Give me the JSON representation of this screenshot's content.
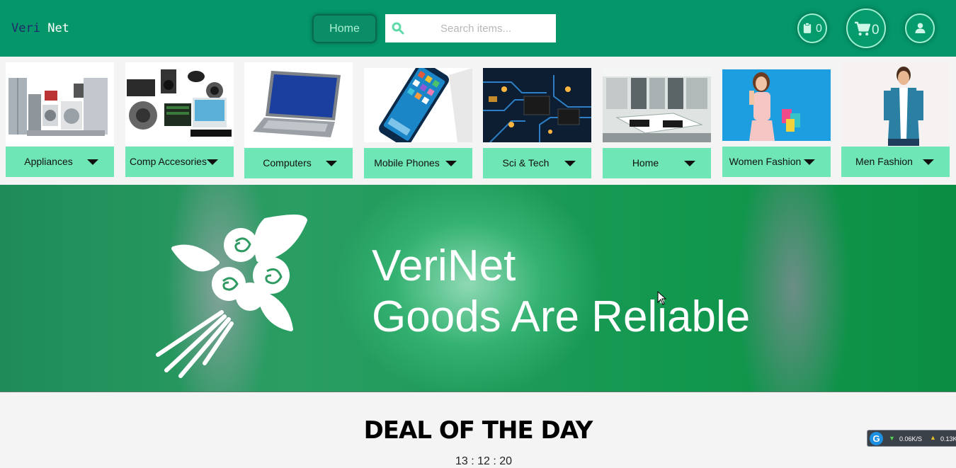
{
  "brand": {
    "part1": "Veri",
    "part2": "Net"
  },
  "nav": {
    "home_label": "Home",
    "search_placeholder": "Search items..."
  },
  "header": {
    "orders_count": "0",
    "cart_count": "0"
  },
  "categories": [
    {
      "label": "Appliances",
      "icon": "appliances-image"
    },
    {
      "label": "Comp Accesories",
      "icon": "computer-accessories-image"
    },
    {
      "label": "Computers",
      "icon": "laptop-image"
    },
    {
      "label": "Mobile Phones",
      "icon": "smartphone-image"
    },
    {
      "label": "Sci & Tech",
      "icon": "circuit-board-image"
    },
    {
      "label": "Home",
      "icon": "kitchen-image"
    },
    {
      "label": "Women Fashion",
      "icon": "woman-shopping-image"
    },
    {
      "label": "Men Fashion",
      "icon": "man-fashion-image"
    }
  ],
  "hero": {
    "line1": "VeriNet",
    "line2": "Goods Are Reliable"
  },
  "deal": {
    "title": "DEAL OF THE DAY",
    "timer": "13 : 12 : 20"
  },
  "network_widget": {
    "download": "0.06K/S",
    "upload": "0.13K"
  },
  "colors": {
    "header": "#05966a",
    "category_bar": "#6ee6b5",
    "accent_text": "#1e2a6b"
  }
}
